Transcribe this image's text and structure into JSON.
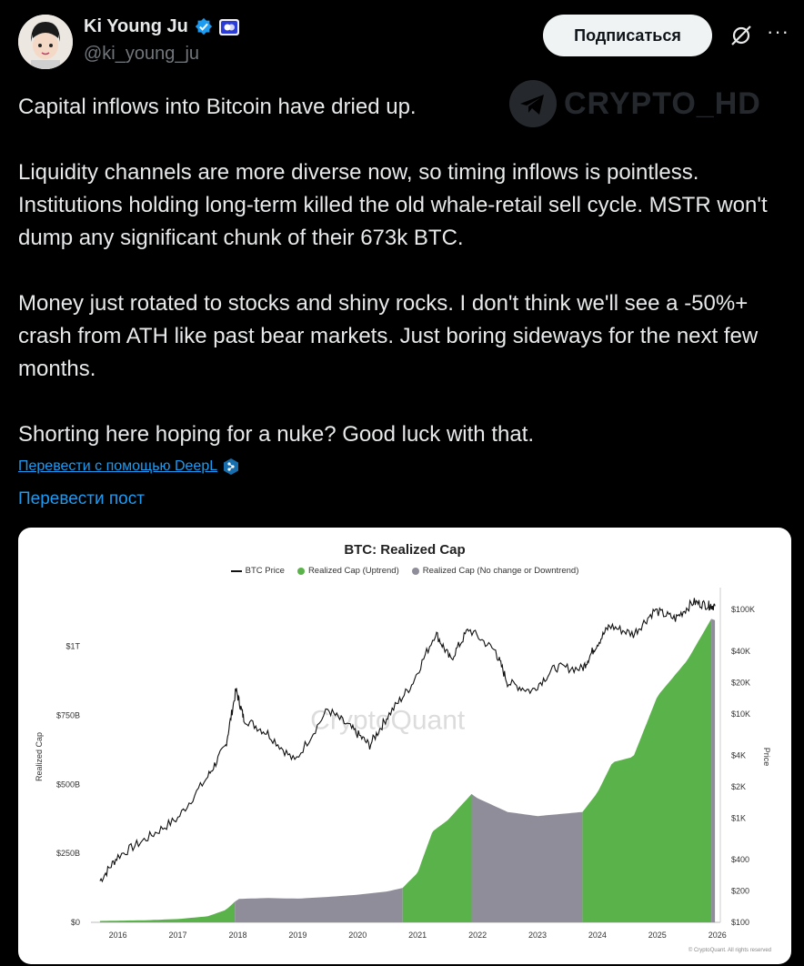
{
  "user": {
    "name": "Ki Young Ju",
    "handle": "@ki_young_ju",
    "follow_label": "Подписаться",
    "more_label": "···"
  },
  "watermark": "CRYPTO_HD",
  "post": {
    "p1": "Capital inflows into Bitcoin have dried up.",
    "p2": "Liquidity channels are more diverse now, so timing inflows is pointless. Institutions holding long-term killed the old whale-retail sell cycle. MSTR won't dump any significant chunk of their 673k BTC.",
    "p3": "Money just rotated to stocks and shiny rocks. I don't think we'll see a -50%+ crash from ATH like past bear markets. Just boring sideways for the next few months.",
    "p4": "Shorting here hoping for a nuke? Good luck with that."
  },
  "translate_deepl": "Перевести с помощью DeepL",
  "translate_post": "Перевести пост",
  "colors": {
    "uptrend": "#5ab34a",
    "downtrend": "#8e8d99",
    "accent": "#1d9bf0"
  },
  "chart_data": {
    "type": "area",
    "title": "BTC: Realized Cap",
    "legend": [
      "BTC Price",
      "Realized Cap (Uptrend)",
      "Realized Cap (No change or Downtrend)"
    ],
    "ylabel": "Realized Cap",
    "y2label": "Price",
    "y_ticks": [
      "$0",
      "$250B",
      "$500B",
      "$750B",
      "$1T"
    ],
    "y2_ticks": [
      "$100",
      "$200",
      "$400",
      "$1K",
      "$2K",
      "$4K",
      "$10K",
      "$20K",
      "$40K",
      "$100K"
    ],
    "x_ticks": [
      "2016",
      "2017",
      "2018",
      "2019",
      "2020",
      "2021",
      "2022",
      "2023",
      "2024",
      "2025",
      "2026"
    ],
    "watermark": "CryptoQuant",
    "footer": "© CryptoQuant. All rights reserved",
    "realized_cap_billions": [
      [
        2015.7,
        5
      ],
      [
        2016.0,
        6
      ],
      [
        2016.5,
        8
      ],
      [
        2017.0,
        12
      ],
      [
        2017.5,
        22
      ],
      [
        2017.8,
        45
      ],
      [
        2018.0,
        85
      ],
      [
        2018.5,
        88
      ],
      [
        2019.0,
        86
      ],
      [
        2019.5,
        92
      ],
      [
        2020.0,
        100
      ],
      [
        2020.5,
        112
      ],
      [
        2020.75,
        125
      ],
      [
        2021.0,
        180
      ],
      [
        2021.25,
        330
      ],
      [
        2021.5,
        370
      ],
      [
        2021.9,
        465
      ],
      [
        2022.0,
        450
      ],
      [
        2022.5,
        400
      ],
      [
        2023.0,
        385
      ],
      [
        2023.5,
        395
      ],
      [
        2023.75,
        400
      ],
      [
        2024.0,
        470
      ],
      [
        2024.25,
        580
      ],
      [
        2024.6,
        600
      ],
      [
        2025.0,
        820
      ],
      [
        2025.5,
        950
      ],
      [
        2025.9,
        1100
      ],
      [
        2025.96,
        1095
      ]
    ],
    "segments": [
      {
        "from": 2015.7,
        "to": 2017.95,
        "trend": "uptrend"
      },
      {
        "from": 2017.95,
        "to": 2020.75,
        "trend": "downtrend"
      },
      {
        "from": 2020.75,
        "to": 2021.9,
        "trend": "uptrend"
      },
      {
        "from": 2021.9,
        "to": 2023.75,
        "trend": "downtrend"
      },
      {
        "from": 2023.75,
        "to": 2025.9,
        "trend": "uptrend"
      },
      {
        "from": 2025.9,
        "to": 2025.96,
        "trend": "downtrend"
      }
    ],
    "btc_price": [
      [
        2015.7,
        250
      ],
      [
        2016.0,
        430
      ],
      [
        2016.5,
        650
      ],
      [
        2017.0,
        1000
      ],
      [
        2017.5,
        2500
      ],
      [
        2017.8,
        5000
      ],
      [
        2017.97,
        17000
      ],
      [
        2018.1,
        9000
      ],
      [
        2018.5,
        6500
      ],
      [
        2018.95,
        3500
      ],
      [
        2019.5,
        11000
      ],
      [
        2019.9,
        7200
      ],
      [
        2020.2,
        5000
      ],
      [
        2020.5,
        9500
      ],
      [
        2020.9,
        19000
      ],
      [
        2021.3,
        60000
      ],
      [
        2021.55,
        33000
      ],
      [
        2021.85,
        65000
      ],
      [
        2022.3,
        40000
      ],
      [
        2022.5,
        20000
      ],
      [
        2022.9,
        16500
      ],
      [
        2023.3,
        28000
      ],
      [
        2023.75,
        27000
      ],
      [
        2023.95,
        43000
      ],
      [
        2024.2,
        70000
      ],
      [
        2024.6,
        58000
      ],
      [
        2024.95,
        98000
      ],
      [
        2025.3,
        82000
      ],
      [
        2025.6,
        118000
      ],
      [
        2025.85,
        110000
      ],
      [
        2025.96,
        108000
      ]
    ]
  }
}
